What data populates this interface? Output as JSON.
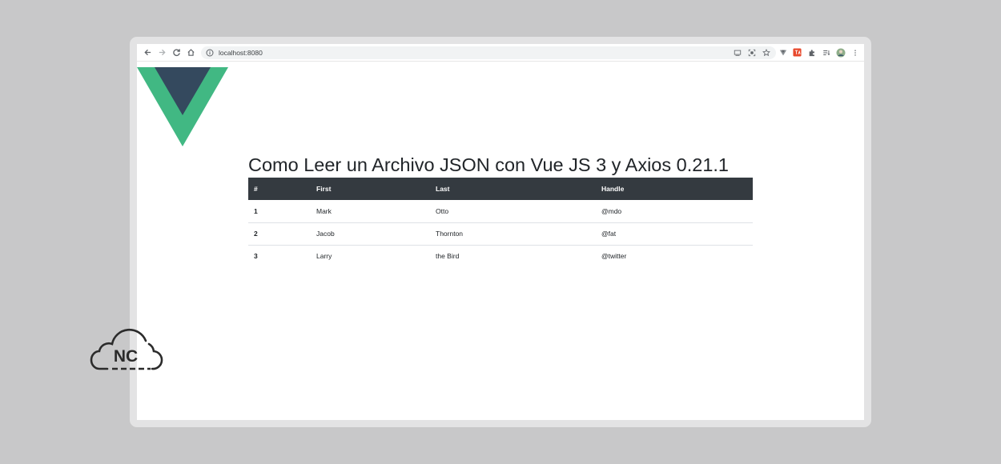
{
  "browser": {
    "url": "localhost:8080"
  },
  "page": {
    "title": "Como Leer un Archivo JSON con Vue JS 3 y Axios 0.21.1"
  },
  "table": {
    "headers": [
      "#",
      "First",
      "Last",
      "Handle"
    ],
    "rows": [
      [
        "1",
        "Mark",
        "Otto",
        "@mdo"
      ],
      [
        "2",
        "Jacob",
        "Thornton",
        "@fat"
      ],
      [
        "3",
        "Larry",
        "the Bird",
        "@twitter"
      ]
    ]
  },
  "watermark": {
    "text": "NC"
  },
  "colors": {
    "vue_green": "#41b883",
    "vue_navy": "#34495e",
    "table_header": "#343a40"
  }
}
